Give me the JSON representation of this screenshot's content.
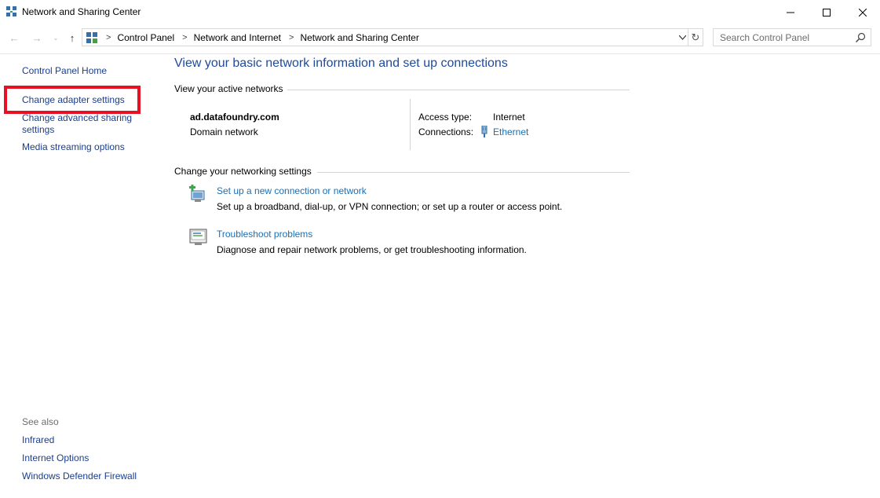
{
  "window": {
    "title": "Network and Sharing Center",
    "min_label": "—",
    "max_label": "☐",
    "close_label": "✕"
  },
  "nav": {
    "back": "←",
    "forward": "→",
    "recent": "⌄",
    "up": "↑",
    "refresh": "↻"
  },
  "breadcrumb": [
    {
      "label": "Control Panel"
    },
    {
      "label": "Network and Internet"
    },
    {
      "label": "Network and Sharing Center"
    }
  ],
  "search": {
    "placeholder": "Search Control Panel"
  },
  "sidebar": {
    "links": [
      {
        "label": "Control Panel Home"
      },
      {
        "label": "Change adapter settings"
      },
      {
        "label": "Change advanced sharing settings"
      },
      {
        "label": "Media streaming options"
      }
    ],
    "see_also_heading": "See also",
    "see_also": [
      {
        "label": "Infrared"
      },
      {
        "label": "Internet Options"
      },
      {
        "label": "Windows Defender Firewall"
      }
    ]
  },
  "main": {
    "title": "View your basic network information and set up connections",
    "active_networks_heading": "View your active networks",
    "network": {
      "name": "ad.datafoundry.com",
      "category": "Domain network",
      "access_type_label": "Access type:",
      "access_type_value": "Internet",
      "connections_label": "Connections:",
      "connections_value": "Ethernet"
    },
    "change_heading": "Change your networking settings",
    "tasks": [
      {
        "icon": "new-connection-icon",
        "link": "Set up a new connection or network",
        "desc": "Set up a broadband, dial-up, or VPN connection; or set up a router or access point."
      },
      {
        "icon": "troubleshoot-icon",
        "link": "Troubleshoot problems",
        "desc": "Diagnose and repair network problems, or get troubleshooting information."
      }
    ]
  },
  "colors": {
    "link": "#1a6fb5",
    "nav_link": "#1a3e8c",
    "title": "#1e4a9a",
    "highlight": "#e81123"
  }
}
